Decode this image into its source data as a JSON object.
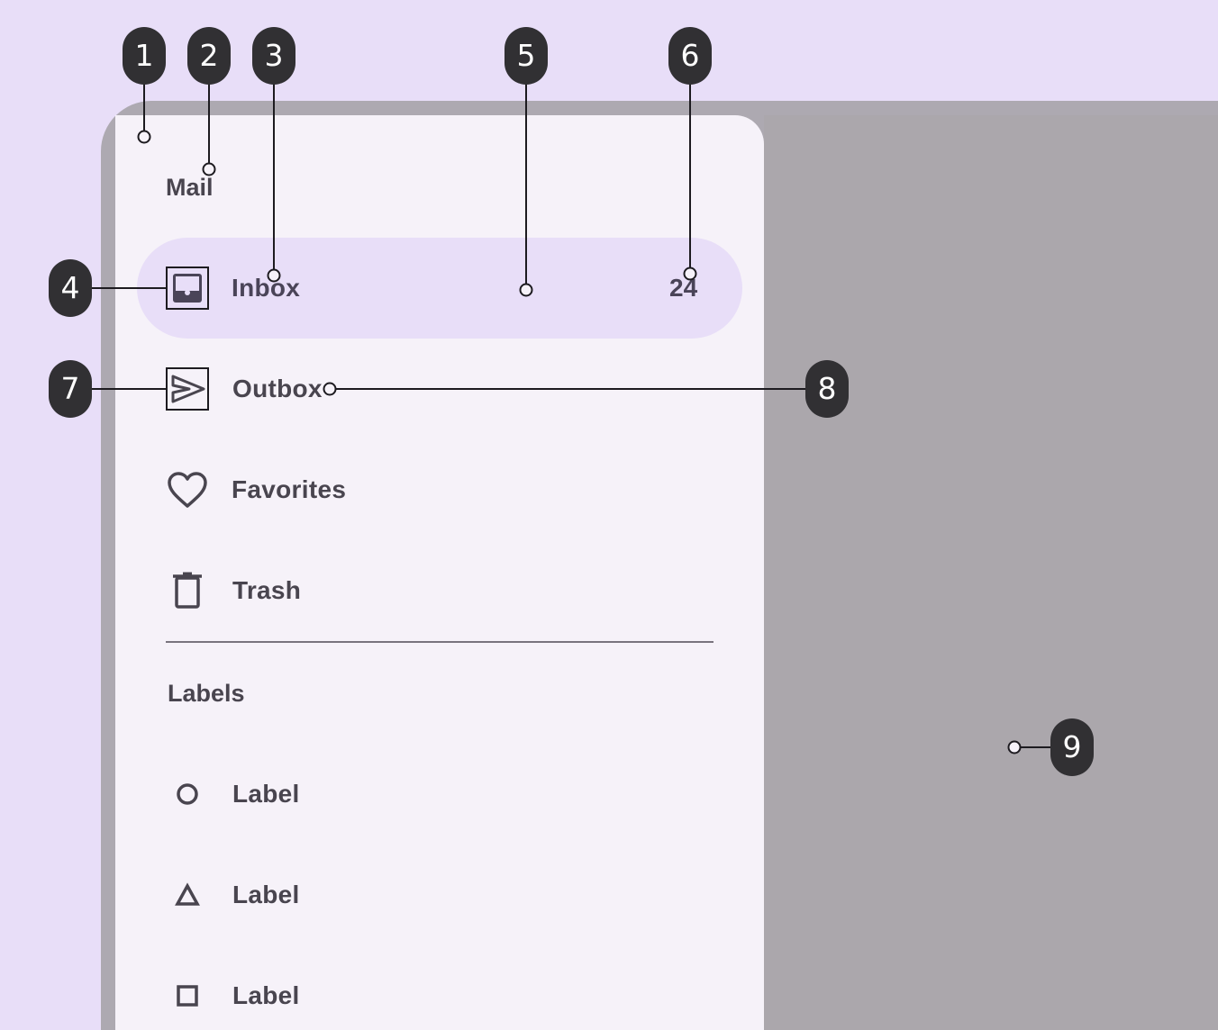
{
  "drawer": {
    "headline": "Mail",
    "items": [
      {
        "label": "Inbox",
        "icon": "inbox-icon",
        "badge": "24",
        "active": true
      },
      {
        "label": "Outbox",
        "icon": "send-icon"
      },
      {
        "label": "Favorites",
        "icon": "heart-icon"
      },
      {
        "label": "Trash",
        "icon": "trash-icon"
      }
    ],
    "section_title": "Labels",
    "labels": [
      {
        "label": "Label",
        "icon": "circle-icon"
      },
      {
        "label": "Label",
        "icon": "triangle-icon"
      },
      {
        "label": "Label",
        "icon": "square-icon"
      }
    ]
  },
  "annotations": [
    "1",
    "2",
    "3",
    "4",
    "5",
    "6",
    "7",
    "8",
    "9"
  ],
  "colors": {
    "background": "#E8DEF8",
    "device_frame": "#ADA9B1",
    "scrim": "#ABA7AC",
    "drawer_surface": "#F6F2F9",
    "active_indicator": "#E8DEF8",
    "on_surface_variant": "#49454F",
    "callout": "#313033"
  }
}
